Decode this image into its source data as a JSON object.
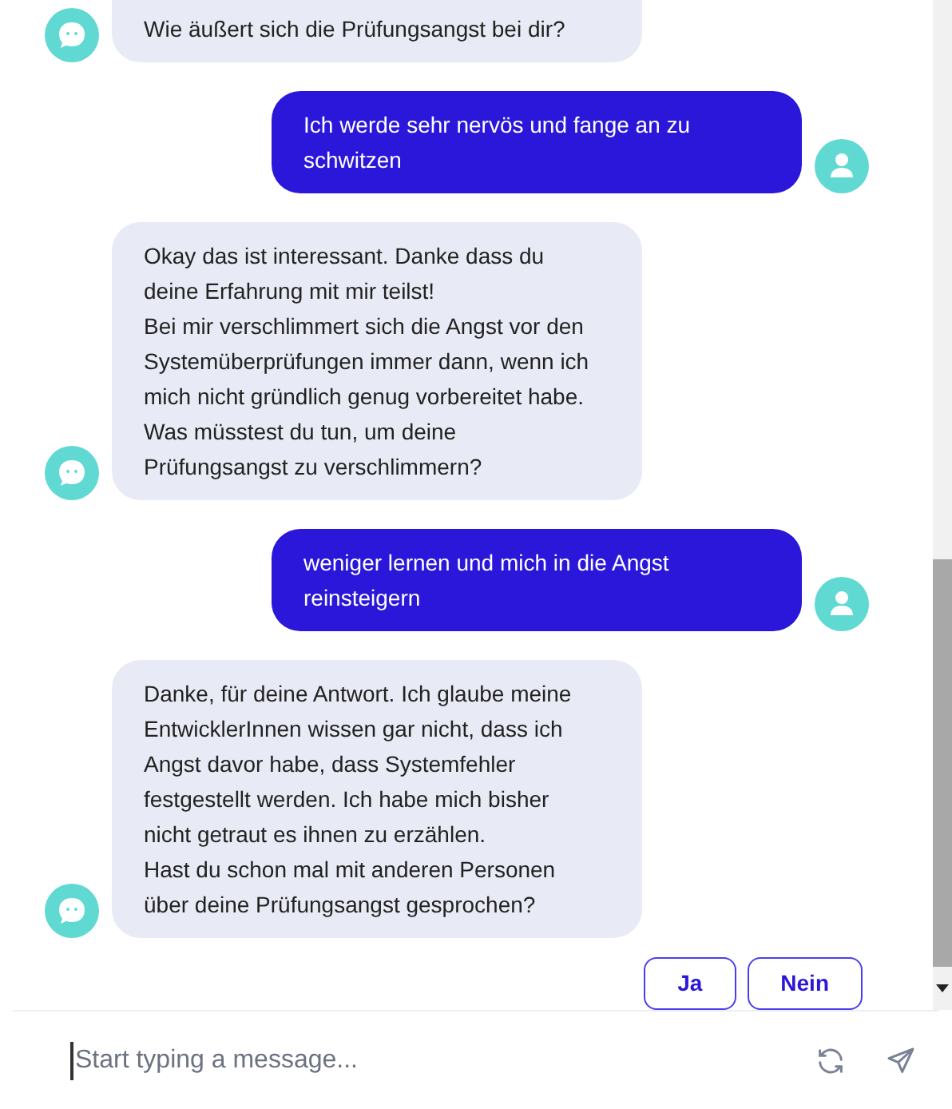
{
  "messages": [
    {
      "kind": "bot",
      "text": "Wie äußert sich die Prüfungsangst bei dir?"
    },
    {
      "kind": "user",
      "text": "Ich werde sehr nervös und fange an zu\nschwitzen"
    },
    {
      "kind": "bot",
      "text": "Okay das ist interessant. Danke dass du\ndeine Erfahrung mit mir teilst!\nBei mir verschlimmert sich die Angst vor den\nSystemüberprüfungen immer dann, wenn ich\nmich nicht gründlich genug vorbereitet habe.\nWas müsstest du tun, um deine\nPrüfungsangst zu verschlimmern?"
    },
    {
      "kind": "user",
      "text": "weniger lernen und mich in die Angst\nreinsteigern"
    },
    {
      "kind": "bot",
      "text": "Danke, für deine Antwort. Ich glaube meine\nEntwicklerInnen wissen gar nicht, dass ich\nAngst davor habe, dass Systemfehler\nfestgestellt werden. Ich habe mich bisher\nnicht getraut es ihnen zu erzählen.\nHast du schon mal mit anderen Personen\nüber deine Prüfungsangst gesprochen?"
    }
  ],
  "quick_replies": [
    "Ja",
    "Nein"
  ],
  "composer": {
    "placeholder": "Start typing a message..."
  }
}
